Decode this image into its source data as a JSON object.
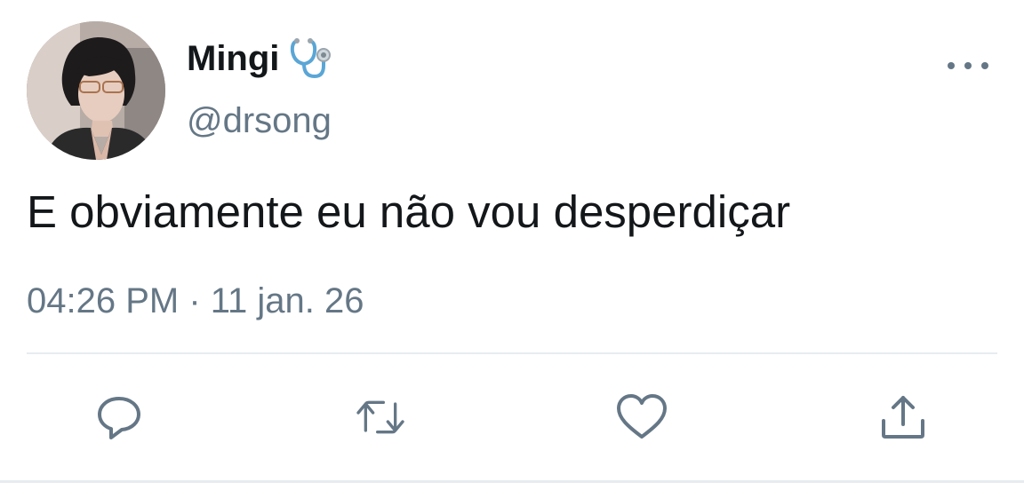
{
  "tweet": {
    "author": {
      "display_name": "Mingi",
      "name_emoji": "stethoscope-icon",
      "handle": "@drsong",
      "avatar": "profile-photo"
    },
    "text": "E obviamente eu não vou desperdiçar",
    "timestamp": "04:26 PM · 11 jan. 26"
  },
  "actions": {
    "reply": "reply-icon",
    "retweet": "retweet-icon",
    "like": "heart-icon",
    "share": "share-icon",
    "more": "more-options-icon"
  },
  "colors": {
    "text_primary": "#14171a",
    "text_secondary": "#657786",
    "divider": "#e6ecf0",
    "icon": "#657786"
  }
}
